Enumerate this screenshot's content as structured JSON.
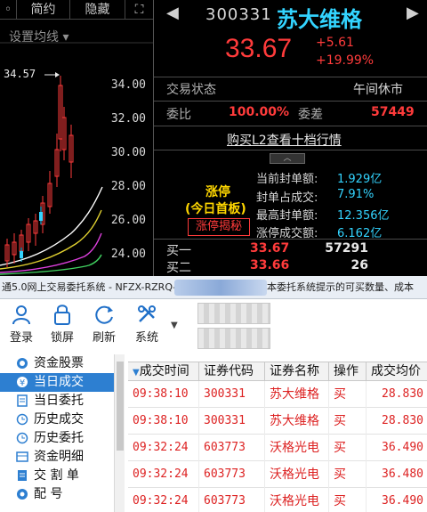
{
  "chart_panel": {
    "tabs": [
      "◦",
      "简约",
      "隐藏",
      "⛶"
    ],
    "settings_label": "设置均线",
    "high_marker": "34.57",
    "price_ticks": [
      "34.00",
      "32.00",
      "30.00",
      "28.00",
      "26.00",
      "24.00"
    ]
  },
  "quote": {
    "code": "300331",
    "name": "苏大维格",
    "price": "33.67",
    "change": "+5.61",
    "change_pct": "+19.99%",
    "status_label": "交易状态",
    "status_value": "午间休市",
    "wei_bi_label": "委比",
    "wei_bi_value": "100.00%",
    "wei_cha_label": "委差",
    "wei_cha_value": "57449",
    "l2_link": "购买L2查看十档行情",
    "limit_up_title": "涨停",
    "limit_up_sub": "(今日首板)",
    "limit_up_button": "涨停揭秘",
    "stats": [
      {
        "label": "当前封单额:",
        "value": "1.929亿"
      },
      {
        "label": "封单占成交:",
        "value": "7.91%"
      },
      {
        "label": "最高封单额:",
        "value": "12.356亿"
      },
      {
        "label": "涨停成交额:",
        "value": "6.162亿"
      }
    ],
    "bids": [
      {
        "label": "买一",
        "price": "33.67",
        "volume": "57291"
      },
      {
        "label": "买二",
        "price": "33.66",
        "volume": "26"
      }
    ],
    "colors": {
      "up": "#ff3b3b",
      "name": "#33d4ff",
      "stat": "#33d4ff",
      "limit": "#ffd700"
    }
  },
  "trade_window": {
    "title_left": "通5.0网上交易委托系统 - NFZX-RZRQ-",
    "title_right": "本委托系统提示的可买数量、成本",
    "toolbar": [
      {
        "label": "登录",
        "icon": "user-icon"
      },
      {
        "label": "锁屏",
        "icon": "lock-icon"
      },
      {
        "label": "刷新",
        "icon": "refresh-icon"
      },
      {
        "label": "系统",
        "icon": "tools-icon"
      }
    ],
    "sidebar": [
      {
        "label": "资金股票",
        "icon": "wallet-icon",
        "selected": false
      },
      {
        "label": "当日成交",
        "icon": "yen-icon",
        "selected": true
      },
      {
        "label": "当日委托",
        "icon": "doc-icon",
        "selected": false
      },
      {
        "label": "历史成交",
        "icon": "history-icon",
        "selected": false
      },
      {
        "label": "历史委托",
        "icon": "history-doc-icon",
        "selected": false
      },
      {
        "label": "资金明细",
        "icon": "ledger-icon",
        "selected": false
      },
      {
        "label": "交 割 单",
        "icon": "delivery-icon",
        "selected": false
      },
      {
        "label": "配    号",
        "icon": "number-icon",
        "selected": false
      }
    ],
    "columns": [
      "成交时间",
      "证券代码",
      "证券名称",
      "操作",
      "成交均价"
    ],
    "rows": [
      [
        "09:38:10",
        "300331",
        "苏大维格",
        "买",
        "28.830"
      ],
      [
        "09:38:10",
        "300331",
        "苏大维格",
        "买",
        "28.830"
      ],
      [
        "09:32:24",
        "603773",
        "沃格光电",
        "买",
        "36.490"
      ],
      [
        "09:32:24",
        "603773",
        "沃格光电",
        "买",
        "36.480"
      ],
      [
        "09:32:24",
        "603773",
        "沃格光电",
        "买",
        "36.490"
      ]
    ]
  }
}
